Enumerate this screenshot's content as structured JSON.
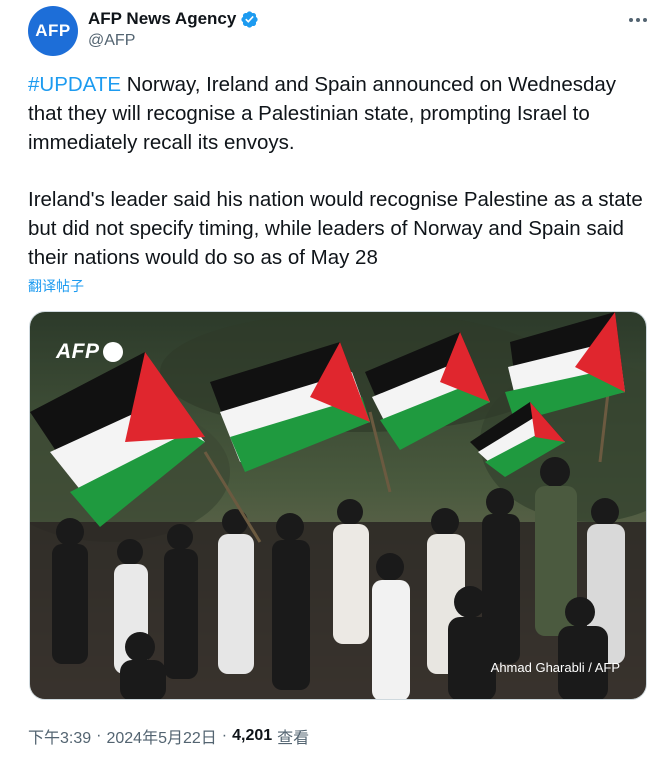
{
  "author": {
    "avatar_text": "AFP",
    "display_name": "AFP News Agency",
    "handle": "@AFP",
    "verified": true
  },
  "tweet": {
    "hashtag": "#UPDATE",
    "paragraph1_rest": " Norway, Ireland and Spain announced on Wednesday that they will recognise a Palestinian state, prompting Israel to immediately recall its envoys.",
    "paragraph2": "Ireland's leader said his nation would recognise Palestine as a state but did not specify timing, while leaders of Norway and Spain said their nations would do so as of May 28",
    "translate_label": "翻译帖子"
  },
  "media": {
    "watermark": "AFP",
    "credit": "Ahmad Gharabli / AFP"
  },
  "meta": {
    "time": "下午3:39",
    "date": "2024年5月22日",
    "separator": "·",
    "views_count": "4,201",
    "views_label": "查看"
  },
  "colors": {
    "accent": "#1d9bf0",
    "avatar_bg": "#1d6ed8",
    "secondary_text": "#536471",
    "flag_red": "#e0262e",
    "flag_green": "#1f9a3f",
    "flag_black": "#111111"
  },
  "icons": {
    "verified": "verified-badge-icon",
    "more": "more-horizontal-icon"
  }
}
